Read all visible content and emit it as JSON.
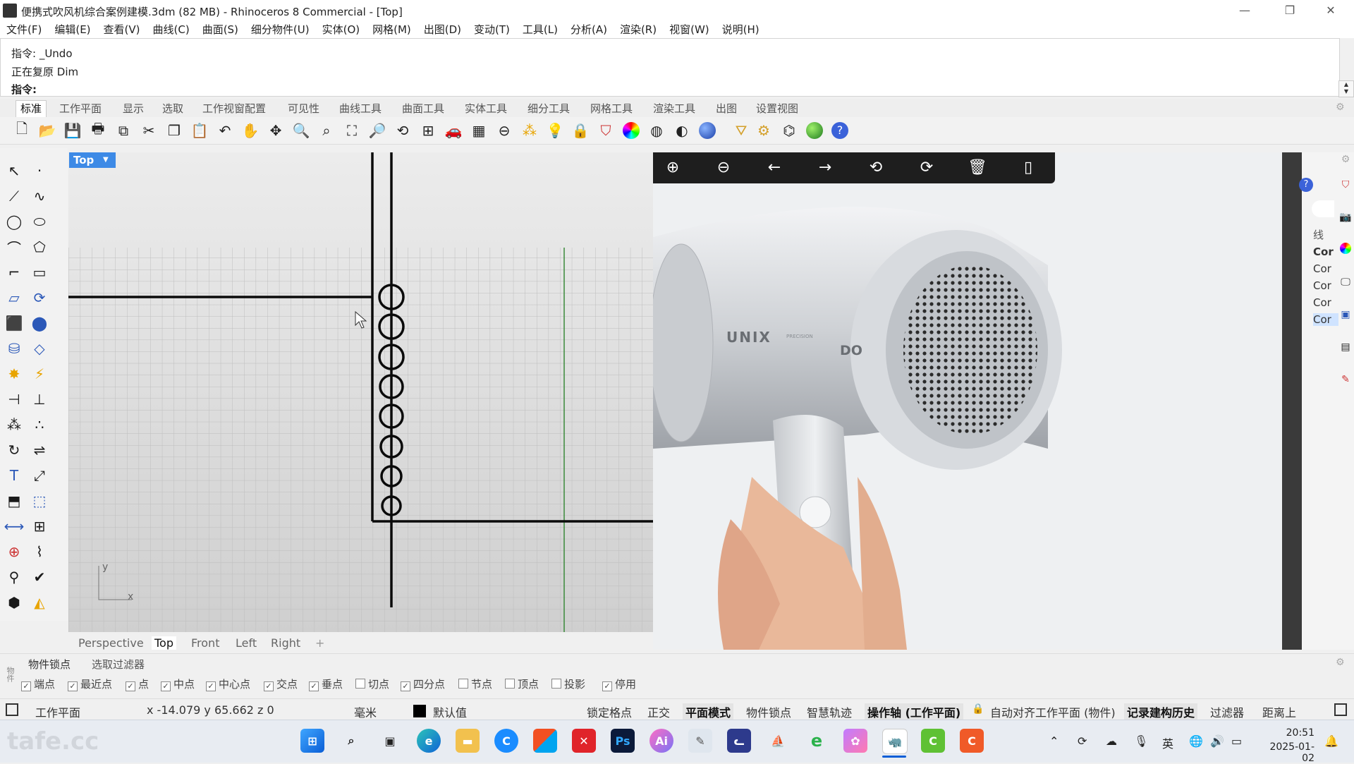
{
  "title_bar": {
    "title": "便携式吹风机综合案例建模.3dm (82 MB) - Rhinoceros 8 Commercial - [Top]",
    "minimize": "—",
    "maximize": "❐",
    "close": "✕"
  },
  "menu": [
    "文件(F)",
    "编辑(E)",
    "查看(V)",
    "曲线(C)",
    "曲面(S)",
    "细分物件(U)",
    "实体(O)",
    "网格(M)",
    "出图(D)",
    "变动(T)",
    "工具(L)",
    "分析(A)",
    "渲染(R)",
    "视窗(W)",
    "说明(H)"
  ],
  "command": {
    "line1": "指令: _Undo",
    "line2": "正在复原 Dim",
    "prompt_label": "指令:",
    "prompt_value": ""
  },
  "toolbar_tabs": [
    "标准",
    "工作平面",
    "显示",
    "选取",
    "工作视窗配置",
    "可见性",
    "曲线工具",
    "曲面工具",
    "实体工具",
    "细分工具",
    "网格工具",
    "渲染工具",
    "出图",
    "设置视图"
  ],
  "toolbar_icons": [
    "new-file-icon",
    "open-folder-icon",
    "save-icon",
    "print-icon",
    "export-icon",
    "cut-icon",
    "copy-icon",
    "paste-icon",
    "undo-icon",
    "pan-hand-icon",
    "rotate-view-icon",
    "zoom-dynamic-icon",
    "zoom-window-icon",
    "zoom-extents-icon",
    "zoom-selected-icon",
    "undo-view-icon",
    "four-viewports-icon",
    "car-icon",
    "grid-surface-icon",
    "cplane-icon",
    "points-icon",
    "light-bulb-icon",
    "lock-icon",
    "layer-icon",
    "color-wheel-icon",
    "wireframe-sphere-icon",
    "shaded-sphere-icon",
    "rendered-sphere-icon",
    "select-filter-icon",
    "settings-gear-icon",
    "history-icon",
    "render-globe-icon",
    "help-icon"
  ],
  "viewport": {
    "label": "Top",
    "axis_x": "x",
    "axis_y": "y",
    "tabs": [
      "Perspective",
      "Top",
      "Front",
      "Left",
      "Right"
    ],
    "active_tab": "Top",
    "add_tab": "+"
  },
  "image_viewer": {
    "tools": [
      "zoom-in-icon",
      "zoom-out-icon",
      "prev-arrow-icon",
      "next-arrow-icon",
      "rotate-left-icon",
      "rotate-right-icon",
      "delete-icon",
      "mouse-icon"
    ],
    "product_brand": "UNIX",
    "product_model": "DO",
    "product_subtext": "PRECISION"
  },
  "right_panel": {
    "header": "线",
    "layers": [
      "Cor",
      "Cor",
      "Cor",
      "Cor",
      "Cor"
    ],
    "selected_index": 4
  },
  "osnap": {
    "tabs": [
      "物件锁点",
      "选取过滤器"
    ],
    "side_label": "物件",
    "snaps": [
      {
        "label": "端点",
        "checked": true
      },
      {
        "label": "最近点",
        "checked": true
      },
      {
        "label": "点",
        "checked": true
      },
      {
        "label": "中点",
        "checked": true
      },
      {
        "label": "中心点",
        "checked": true
      },
      {
        "label": "交点",
        "checked": true
      },
      {
        "label": "垂点",
        "checked": true
      },
      {
        "label": "切点",
        "checked": false
      },
      {
        "label": "四分点",
        "checked": true
      },
      {
        "label": "节点",
        "checked": false
      },
      {
        "label": "顶点",
        "checked": false
      },
      {
        "label": "投影",
        "checked": false
      },
      {
        "label": "停用",
        "checked": true
      }
    ]
  },
  "status": {
    "cplane": "工作平面",
    "coords": "x -14.079   y 65.662   z 0",
    "units": "毫米",
    "layer": "默认值",
    "items": [
      "锁定格点",
      "正交",
      "平面模式",
      "物件锁点",
      "智慧轨迹",
      "操作轴 (工作平面)",
      "自动对齐工作平面 (物件)",
      "记录建构历史",
      "过滤器",
      "距离上"
    ],
    "bold_items": [
      "平面模式",
      "操作轴 (工作平面)",
      "记录建构历史"
    ]
  },
  "taskbar": {
    "watermark": "tafe.cc",
    "apps": [
      "windows-start-icon",
      "search-icon",
      "task-view-icon",
      "edge-browser-icon",
      "file-explorer-icon",
      "app-blue-icon",
      "app-store-icon",
      "xmind-icon",
      "photoshop-icon",
      "ai-app-icon",
      "paint-icon",
      "cat-app-icon",
      "sail-app-icon",
      "edge-green-icon",
      "app-purple-icon",
      "rhino-icon",
      "app-green-c-icon",
      "app-red-c-icon"
    ],
    "tray": {
      "ime": "英",
      "time": "20:51",
      "date": "2025-01-02"
    }
  }
}
